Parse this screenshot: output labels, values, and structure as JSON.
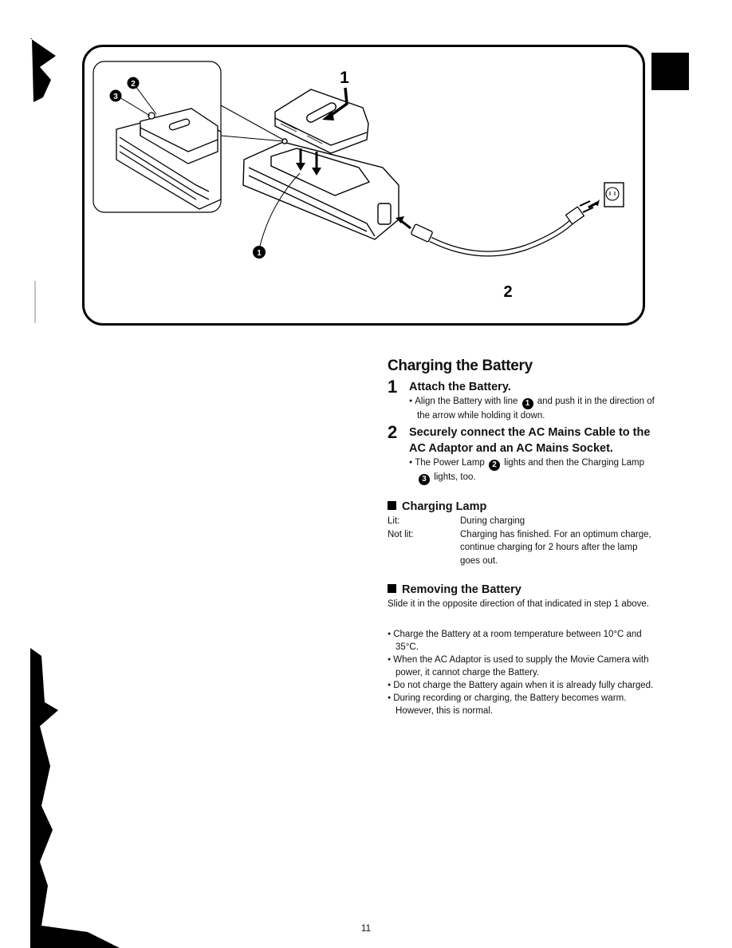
{
  "figure": {
    "step_labels": [
      "1",
      "2"
    ],
    "callouts": [
      "1",
      "2",
      "3"
    ],
    "callout_meanings": {
      "1": "line",
      "2": "power-lamp",
      "3": "charging-lamp"
    }
  },
  "content": {
    "title": "Charging the Battery",
    "steps": [
      {
        "number": "1",
        "title": "Attach the Battery.",
        "bullet_parts": [
          "Align the Battery with line ",
          "1",
          " and push it in the direction of the arrow while holding it down."
        ]
      },
      {
        "number": "2",
        "title": "Securely connect the AC Mains Cable to the AC Adaptor and an AC Mains Socket.",
        "bullet_parts": [
          "The Power Lamp ",
          "2",
          " lights and then the Charging Lamp ",
          "3",
          " lights, too."
        ]
      }
    ],
    "charging_lamp": {
      "heading": "Charging Lamp",
      "rows": [
        {
          "state": "Lit:",
          "meaning": "During charging"
        },
        {
          "state": "Not lit:",
          "meaning": "Charging has finished. For an optimum charge, continue charging for 2 hours after the lamp goes out."
        }
      ]
    },
    "removing": {
      "heading": "Removing the Battery",
      "text": "Slide it in the opposite direction of that indicated in step 1 above."
    },
    "notes": [
      "Charge the Battery at a room temperature between 10°C and 35°C.",
      "When the AC Adaptor is used to supply the Movie Camera with power, it cannot charge the Battery.",
      "Do not charge the Battery again when it is already fully charged.",
      "During recording or charging, the Battery becomes warm. However, this is normal."
    ]
  },
  "page_number": "11"
}
